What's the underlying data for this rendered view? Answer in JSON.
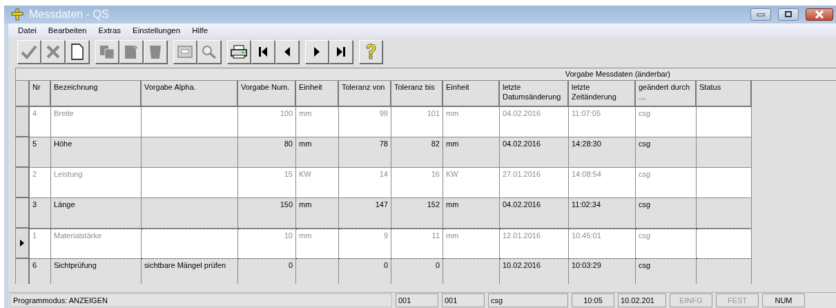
{
  "window": {
    "title": "Messdaten - QS"
  },
  "menu": [
    "Datei",
    "Bearbeiten",
    "Extras",
    "Einstellungen",
    "Hilfe"
  ],
  "toolbar": [
    {
      "kind": "check",
      "disabled": true
    },
    {
      "kind": "cancel",
      "disabled": true
    },
    {
      "kind": "new",
      "disabled": false
    },
    {
      "kind": "copy",
      "disabled": true
    },
    {
      "kind": "edit",
      "disabled": true
    },
    {
      "kind": "delete",
      "disabled": true
    },
    {
      "kind": "archive",
      "disabled": true
    },
    {
      "kind": "search",
      "disabled": true
    },
    {
      "kind": "print",
      "disabled": false
    },
    {
      "kind": "first",
      "disabled": false
    },
    {
      "kind": "prev",
      "disabled": false
    },
    {
      "kind": "next",
      "disabled": false
    },
    {
      "kind": "last",
      "disabled": false
    },
    {
      "kind": "help",
      "disabled": false
    }
  ],
  "group_header": "Vorgabe Messdaten (änderbar)",
  "table": {
    "columns": [
      "Nr",
      "Bezeichnung",
      "Vorgabe Alpha.",
      "Vorgabe Num.",
      "Einheit",
      "Toleranz von",
      "Toleranz bis",
      "Einheit",
      "letzte Datumsänderung",
      "letzte Zeitänderung",
      "geändert durch …",
      "Status"
    ],
    "rows": [
      {
        "dimmed": true,
        "selected": false,
        "cells": [
          "4",
          "Breite",
          "",
          "100",
          "mm",
          "99",
          "101",
          "mm",
          "04.02.2016",
          "11:07:05",
          "csg",
          ""
        ]
      },
      {
        "dimmed": false,
        "selected": false,
        "cells": [
          "5",
          "Höhe",
          "",
          "80",
          "mm",
          "78",
          "82",
          "mm",
          "04.02.2016",
          "14:28:30",
          "csg",
          ""
        ]
      },
      {
        "dimmed": true,
        "selected": false,
        "cells": [
          "2",
          "Leistung",
          "",
          "15",
          "KW",
          "14",
          "16",
          "KW",
          "27.01.2016",
          "14:08:54",
          "csg",
          ""
        ]
      },
      {
        "dimmed": false,
        "selected": false,
        "cells": [
          "3",
          "Länge",
          "",
          "150",
          "mm",
          "147",
          "152",
          "mm",
          "04.02.2016",
          "11:02:34",
          "csg",
          ""
        ]
      },
      {
        "dimmed": true,
        "selected": true,
        "cells": [
          "1",
          "Materialstärke",
          "",
          "10",
          "mm",
          "9",
          "11",
          "mm",
          "12.01.2016",
          "10:45:01",
          "csg",
          ""
        ]
      },
      {
        "dimmed": false,
        "selected": false,
        "cells": [
          "6",
          "Sichtprüfung",
          "sichtbare Mängel prüfen",
          "0",
          "",
          "0",
          "0",
          "",
          "10.02.2016",
          "10:03:29",
          "csg",
          ""
        ]
      }
    ]
  },
  "status_bar": {
    "mode": "Programmodus:  ANZEIGEN",
    "fields": [
      {
        "text": "001",
        "disabled": false
      },
      {
        "text": "001",
        "disabled": false
      },
      {
        "text": "csg",
        "disabled": false
      },
      {
        "text": "10:05",
        "disabled": false
      },
      {
        "text": "10.02.201",
        "disabled": false
      },
      {
        "text": "EINFG",
        "disabled": true
      },
      {
        "text": "FEST",
        "disabled": true
      },
      {
        "text": "NUM",
        "disabled": false
      }
    ]
  }
}
